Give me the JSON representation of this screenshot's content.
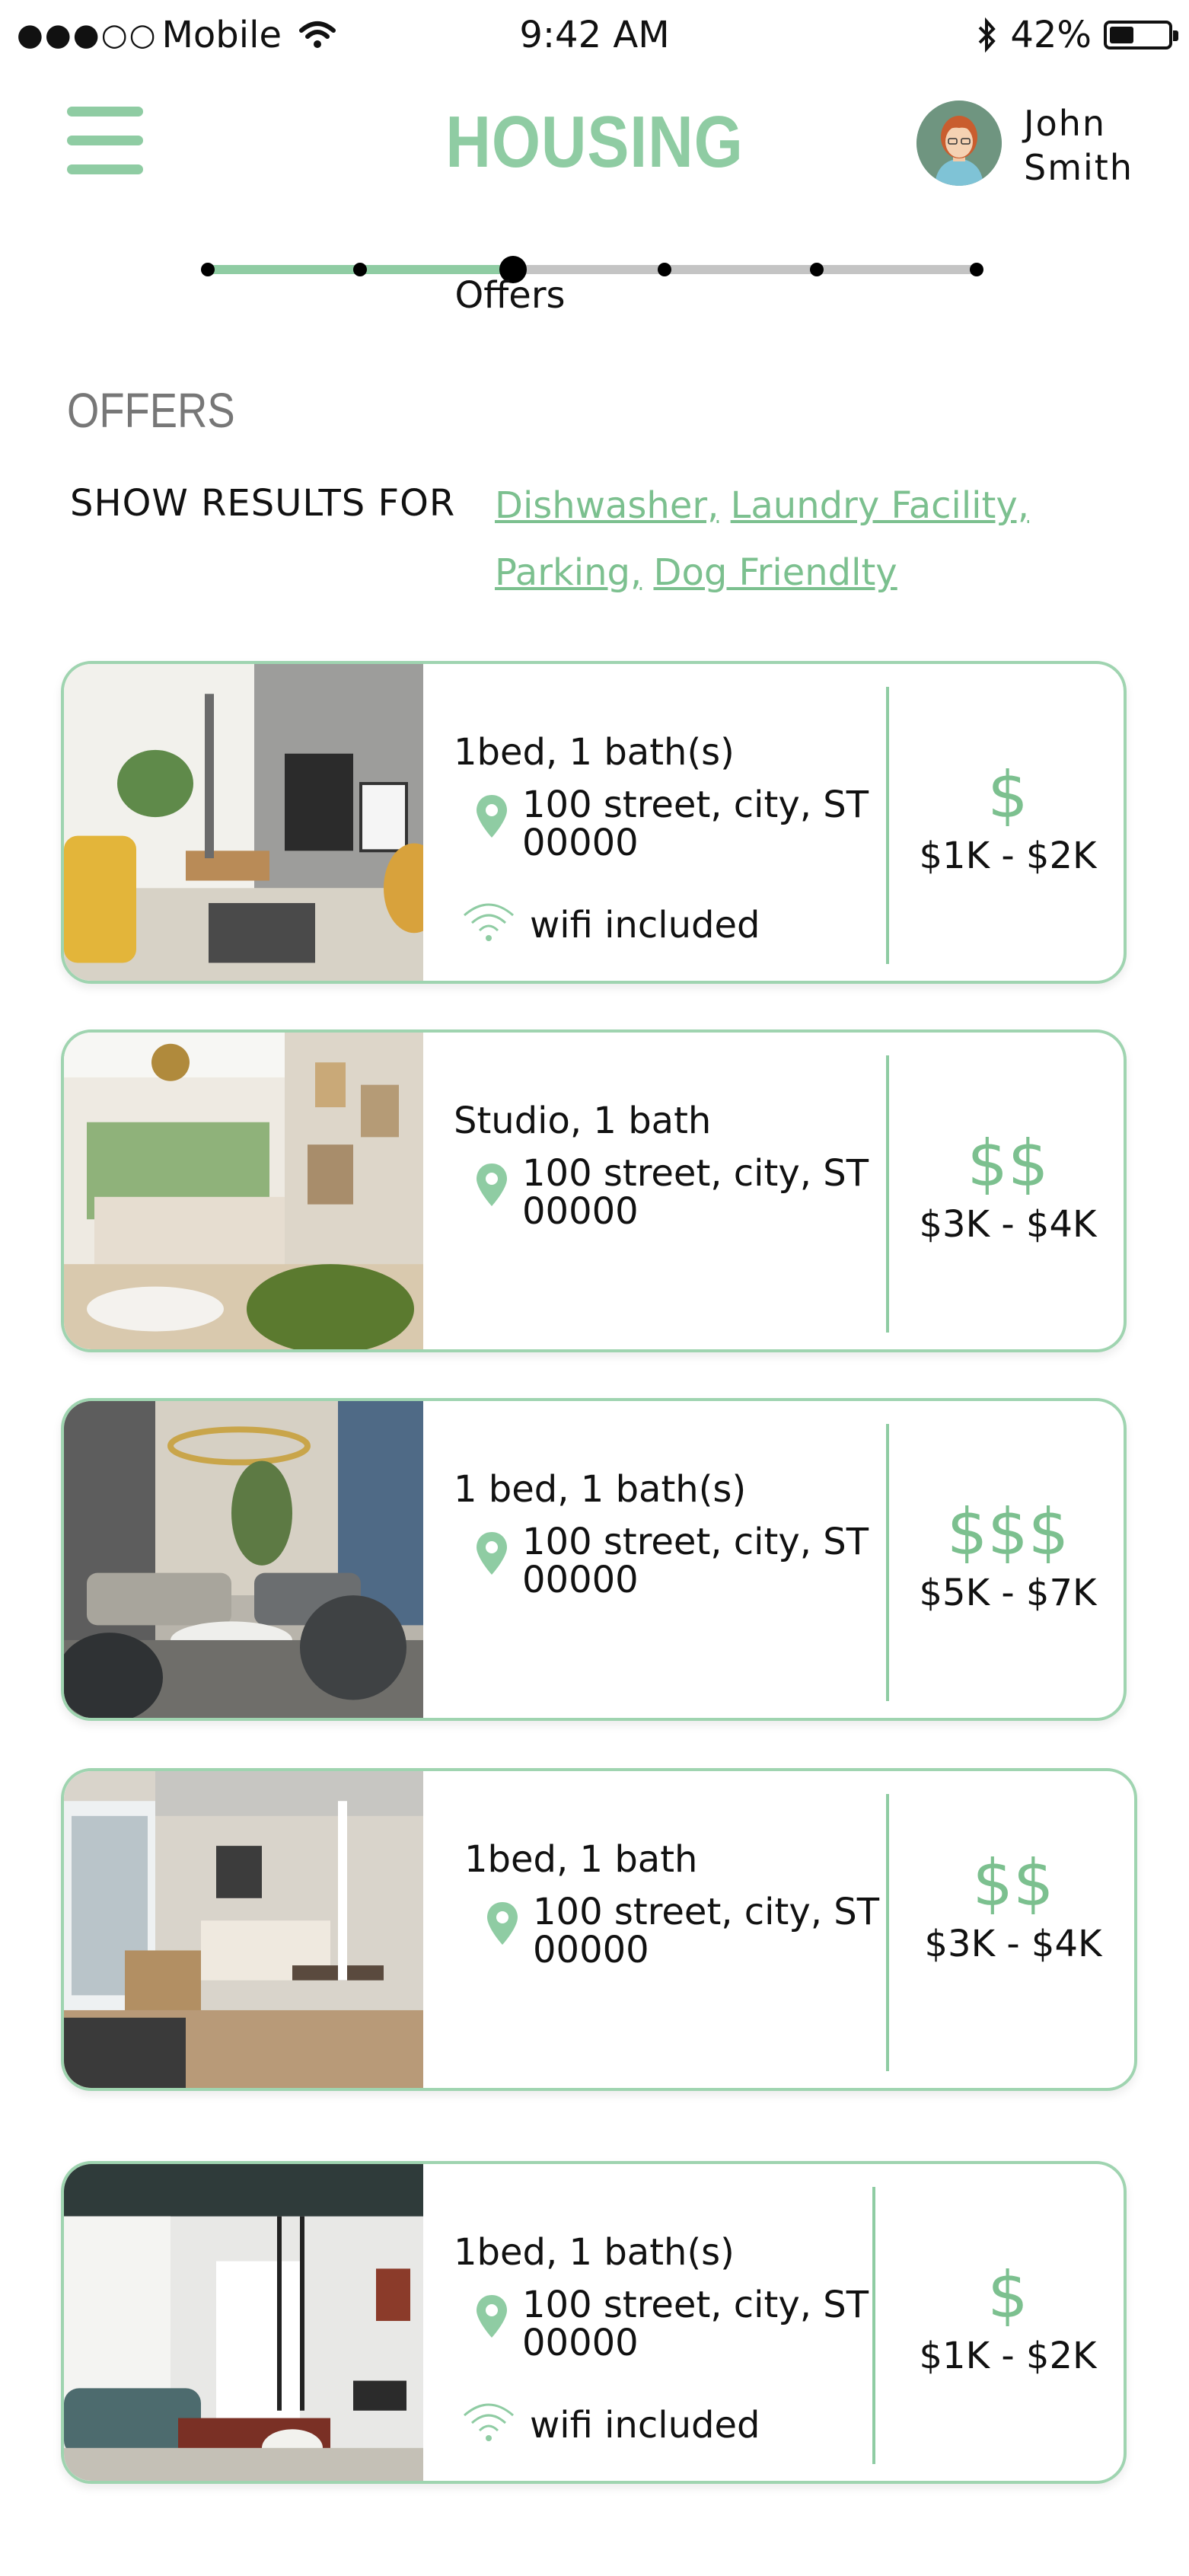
{
  "status_bar": {
    "signal": "●●●○○",
    "carrier": "Mobile",
    "time": "9:42 AM",
    "battery": "42%",
    "battery_level": 0.42
  },
  "header": {
    "title": "HOUSING",
    "user_first": "John",
    "user_last": "Smith"
  },
  "progress": {
    "current_label": "Offers",
    "total_steps": 6,
    "current_step": 3
  },
  "offers": {
    "title": "OFFERS",
    "filter_label": "SHOW RESULTS FOR",
    "filters": [
      "Dishwasher,",
      "Laundry Facility,",
      "Parking,",
      "Dog Friendlty"
    ]
  },
  "listings": [
    {
      "beds": "1bed, 1 bath(s)",
      "address_line1": "100 street, city, ST",
      "address_line2": "00000",
      "amenity": "wifi included",
      "price_symbol": "$",
      "price_range": "$1K - $2K"
    },
    {
      "beds": "Studio, 1 bath",
      "address_line1": "100 street, city, ST",
      "address_line2": "00000",
      "amenity": "",
      "price_symbol": "$$",
      "price_range": "$3K - $4K"
    },
    {
      "beds": "1 bed, 1 bath(s)",
      "address_line1": "100 street, city, ST",
      "address_line2": "00000",
      "amenity": "",
      "price_symbol": "$$$",
      "price_range": "$5K - $7K"
    },
    {
      "beds": "1bed, 1 bath",
      "address_line1": "100 street, city, ST",
      "address_line2": "00000",
      "amenity": "",
      "price_symbol": "$$",
      "price_range": "$3K - $4K"
    },
    {
      "beds": "1bed, 1 bath(s)",
      "address_line1": "100 street, city, ST",
      "address_line2": "00000",
      "amenity": "wifi included",
      "price_symbol": "$",
      "price_range": "$1K - $2K"
    }
  ],
  "colors": {
    "accent": "#8fcca3",
    "link": "#7cc08f",
    "track_inactive": "#c4c4c4"
  }
}
